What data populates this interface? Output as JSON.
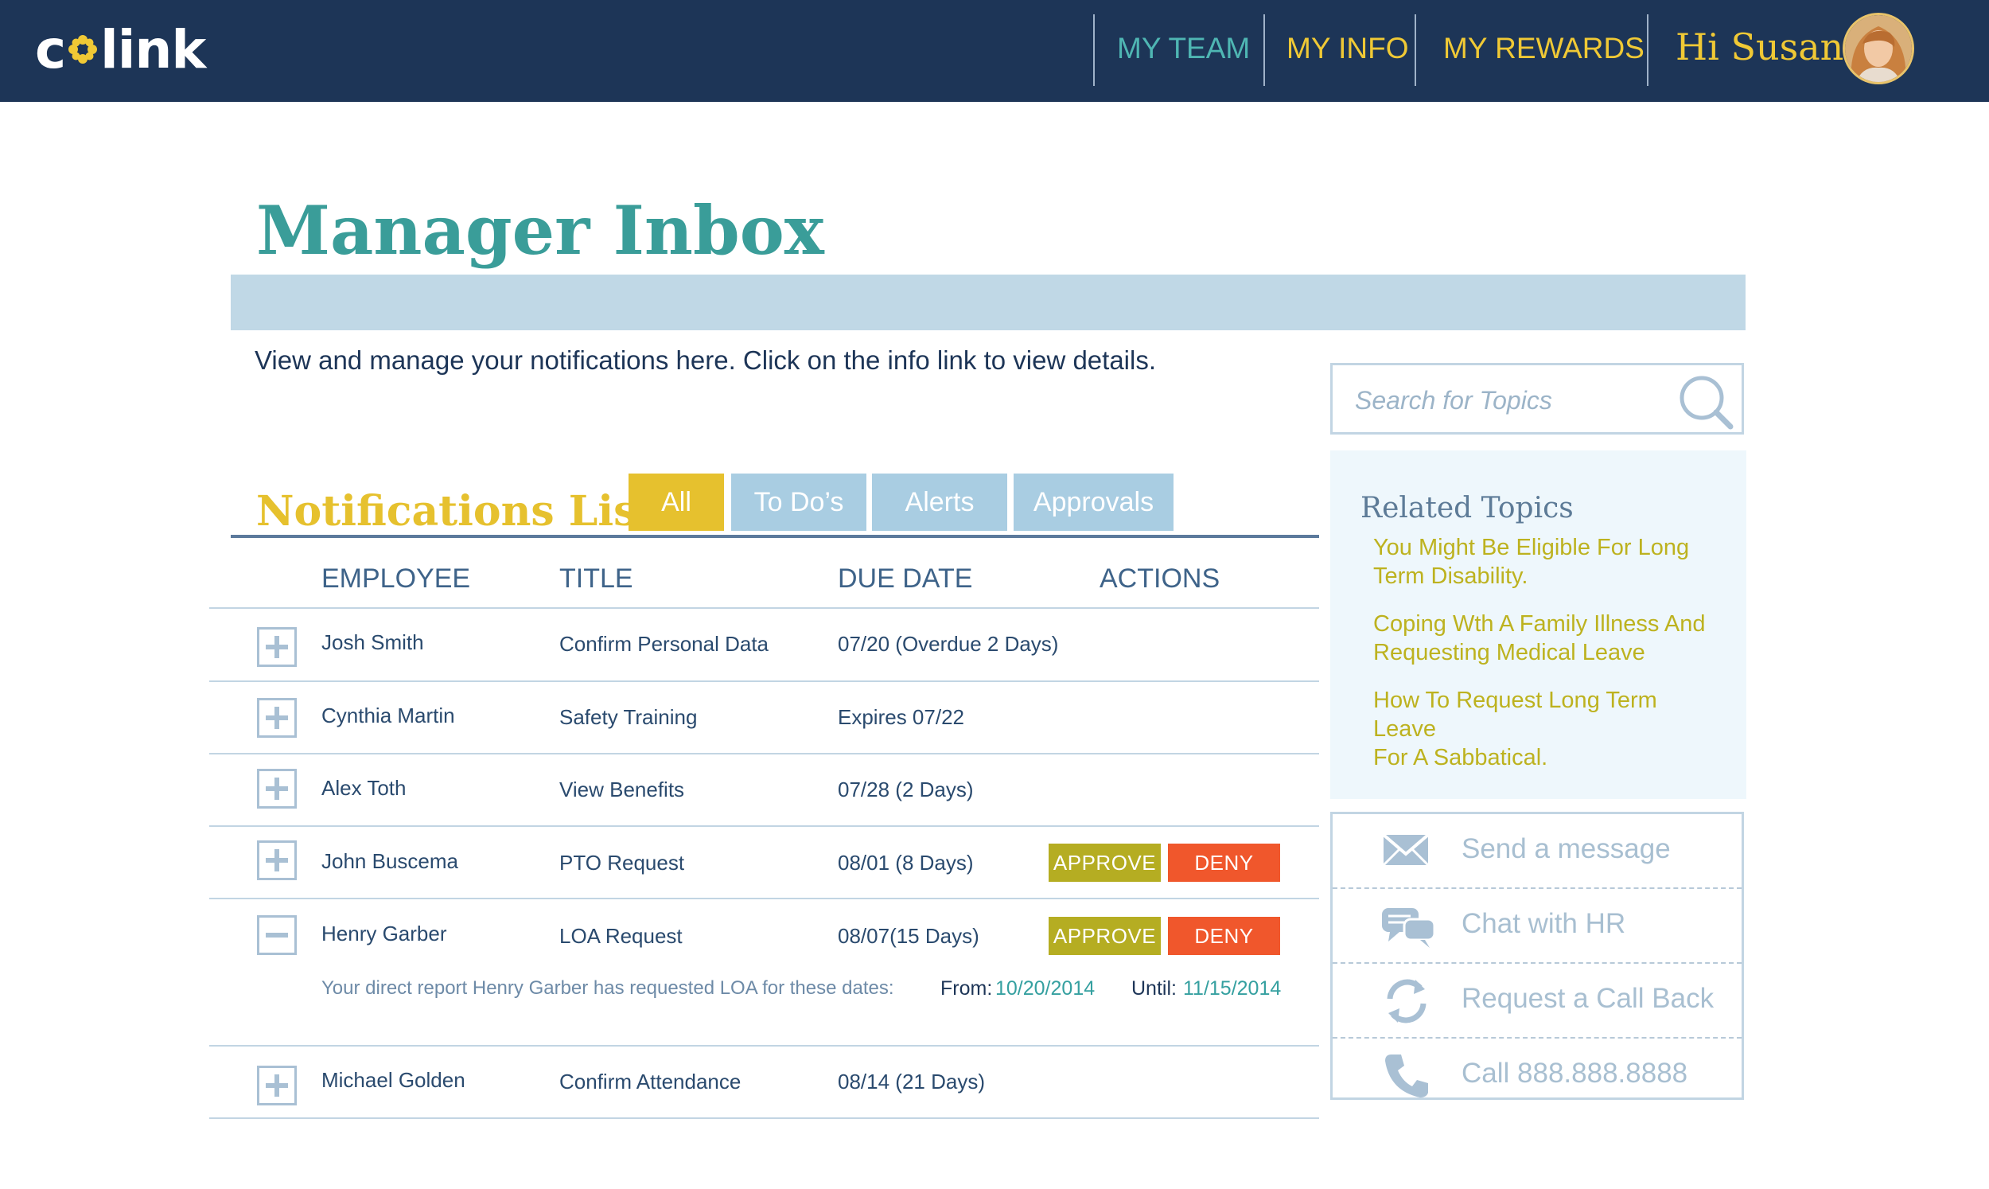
{
  "header": {
    "logo_text_left": "c",
    "logo_text_right": "link",
    "nav": [
      {
        "label": "MY TEAM",
        "color": "#4fb6b3"
      },
      {
        "label": "MY INFO",
        "color": "#f0c935"
      },
      {
        "label": "MY REWARDS",
        "color": "#f0c935"
      }
    ],
    "greeting": "Hi Susan"
  },
  "page": {
    "title": "Manager Inbox",
    "intro": "View and manage your notifications here. Click on the info link to view details."
  },
  "notifications": {
    "title": "Notifications List",
    "filters": [
      {
        "label": "All",
        "active": true
      },
      {
        "label": "To Do’s",
        "active": false
      },
      {
        "label": "Alerts",
        "active": false
      },
      {
        "label": "Approvals",
        "active": false
      }
    ],
    "columns": [
      "EMPLOYEE",
      "TITLE",
      "DUE DATE",
      "ACTIONS"
    ],
    "approve_label": "APPROVE",
    "deny_label": "DENY",
    "rows": [
      {
        "employee": "Josh Smith",
        "title": "Confirm Personal Data",
        "due": "07/20 (Overdue 2 Days)",
        "expanded": false,
        "actions": false
      },
      {
        "employee": "Cynthia Martin",
        "title": "Safety Training",
        "due": "Expires 07/22",
        "expanded": false,
        "actions": false
      },
      {
        "employee": "Alex Toth",
        "title": "View Benefits",
        "due": "07/28 (2 Days)",
        "expanded": false,
        "actions": false
      },
      {
        "employee": "John Buscema",
        "title": "PTO Request",
        "due": "08/01 (8 Days)",
        "expanded": false,
        "actions": true
      },
      {
        "employee": "Henry Garber",
        "title": "LOA Request",
        "due": "08/07(15 Days)",
        "expanded": true,
        "actions": true
      },
      {
        "employee": "Michael Golden",
        "title": "Confirm Attendance",
        "due": "08/14 (21 Days)",
        "expanded": false,
        "actions": false
      }
    ],
    "detail": {
      "text": "Your direct report Henry Garber has requested LOA for these dates:",
      "from_label": "From:",
      "from_date": "10/20/2014",
      "until_label": "Until:",
      "until_date": "11/15/2014"
    }
  },
  "search": {
    "placeholder": "Search for Topics"
  },
  "related": {
    "heading": "Related Topics",
    "links": [
      "You Might Be Eligible For Long Term Disability.",
      "Coping  Wth A Family Illness And Requesting Medical Leave",
      "How To Request Long Term Leave",
      "For A Sabbatical."
    ]
  },
  "contact": {
    "items": [
      {
        "label": "Send a message",
        "icon": "envelope-icon"
      },
      {
        "label": "Chat with HR",
        "icon": "chat-icon"
      },
      {
        "label": "Request a Call Back",
        "icon": "refresh-icon"
      },
      {
        "label": "Call 888.888.8888",
        "icon": "phone-icon"
      }
    ]
  },
  "colors": {
    "navy": "#1d3557",
    "teal": "#3a9d99",
    "yellow": "#e6c12e",
    "approve": "#b5ad22",
    "deny": "#f0572c",
    "tab_active": "#e6c12e",
    "tab_inactive": "#a9cde2"
  }
}
